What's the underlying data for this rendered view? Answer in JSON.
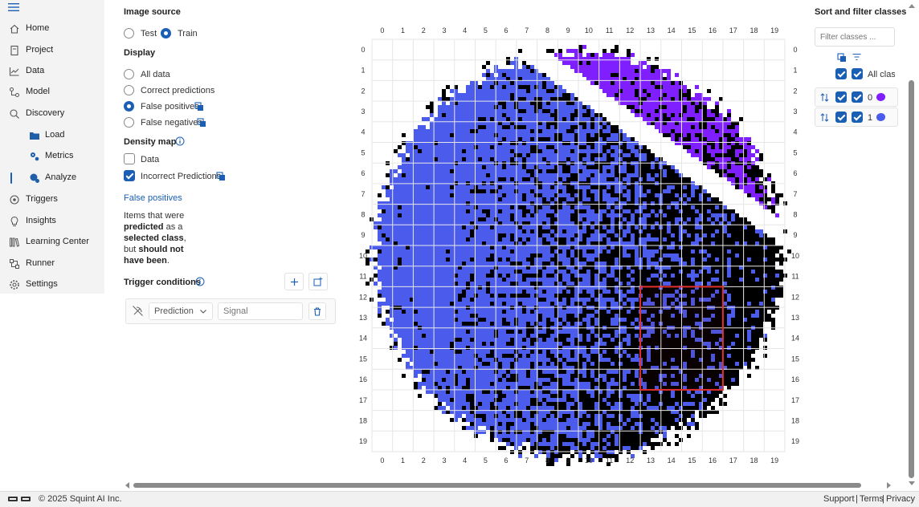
{
  "sidebar": {
    "items": [
      {
        "label": "Home",
        "icon": "home-icon"
      },
      {
        "label": "Project",
        "icon": "project-icon"
      },
      {
        "label": "Data",
        "icon": "data-icon"
      },
      {
        "label": "Model",
        "icon": "model-icon"
      },
      {
        "label": "Discovery",
        "icon": "discovery-icon"
      },
      {
        "label": "Load",
        "icon": "folder-icon"
      },
      {
        "label": "Metrics",
        "icon": "metrics-icon"
      },
      {
        "label": "Analyze",
        "icon": "analyze-icon"
      },
      {
        "label": "Triggers",
        "icon": "triggers-icon"
      },
      {
        "label": "Insights",
        "icon": "insights-icon"
      },
      {
        "label": "Learning Center",
        "icon": "learning-center-icon"
      },
      {
        "label": "Runner",
        "icon": "runner-icon"
      },
      {
        "label": "Settings",
        "icon": "settings-icon"
      }
    ],
    "active": "Analyze"
  },
  "filters": {
    "image_source_title": "Image source",
    "source_options": [
      {
        "label": "Test",
        "selected": false
      },
      {
        "label": "Train",
        "selected": true
      }
    ],
    "display_title": "Display",
    "display_options": [
      {
        "label": "All data",
        "selected": false
      },
      {
        "label": "Correct predictions",
        "selected": false
      },
      {
        "label": "False positives",
        "selected": true
      },
      {
        "label": "False negatives",
        "selected": false
      }
    ],
    "density_title": "Density map",
    "density_options": [
      {
        "label": "Data",
        "checked": false
      },
      {
        "label": "Incorrect Predictions",
        "checked": true
      }
    ],
    "info_title": "False positives",
    "desc": {
      "t1": "Items that were",
      "b1": "predicted",
      "t2": " as a",
      "b2": "selected class",
      "t3": ",",
      "t4": "but ",
      "b3": "should not",
      "b4": "have been",
      "t5": "."
    },
    "trigger_title": "Trigger conditions",
    "trigger_select": "Prediction",
    "trigger_placeholder": "Signal"
  },
  "grid": {
    "x_ticks": [
      "0",
      "1",
      "2",
      "3",
      "4",
      "5",
      "6",
      "7",
      "8",
      "9",
      "10",
      "11",
      "12",
      "13",
      "14",
      "15",
      "16",
      "17",
      "18",
      "19"
    ],
    "y_ticks": [
      "0",
      "1",
      "2",
      "3",
      "4",
      "5",
      "6",
      "7",
      "8",
      "9",
      "10",
      "11",
      "12",
      "13",
      "14",
      "15",
      "16",
      "17",
      "18",
      "19"
    ],
    "selection": {
      "x_from": 13,
      "x_to": 16,
      "y_from": 12,
      "y_to": 16
    },
    "colors": {
      "class0": "#7f1fff",
      "class1": "#4b5cec",
      "incorrect": "#000000",
      "selection": "#e0312f",
      "grid": "#e6e6e6"
    }
  },
  "classes_panel": {
    "title": "Sort and filter classes",
    "filter_placeholder": "Filter classes ...",
    "all_label": "All classes",
    "rows": [
      {
        "label": "0",
        "color": "#7f1fff"
      },
      {
        "label": "1",
        "color": "#4b5cec"
      }
    ]
  },
  "footer": {
    "copyright": "© 2025 Squint AI Inc.",
    "support": "Support",
    "terms": "Terms",
    "privacy": "Privacy",
    "sep": "|"
  }
}
